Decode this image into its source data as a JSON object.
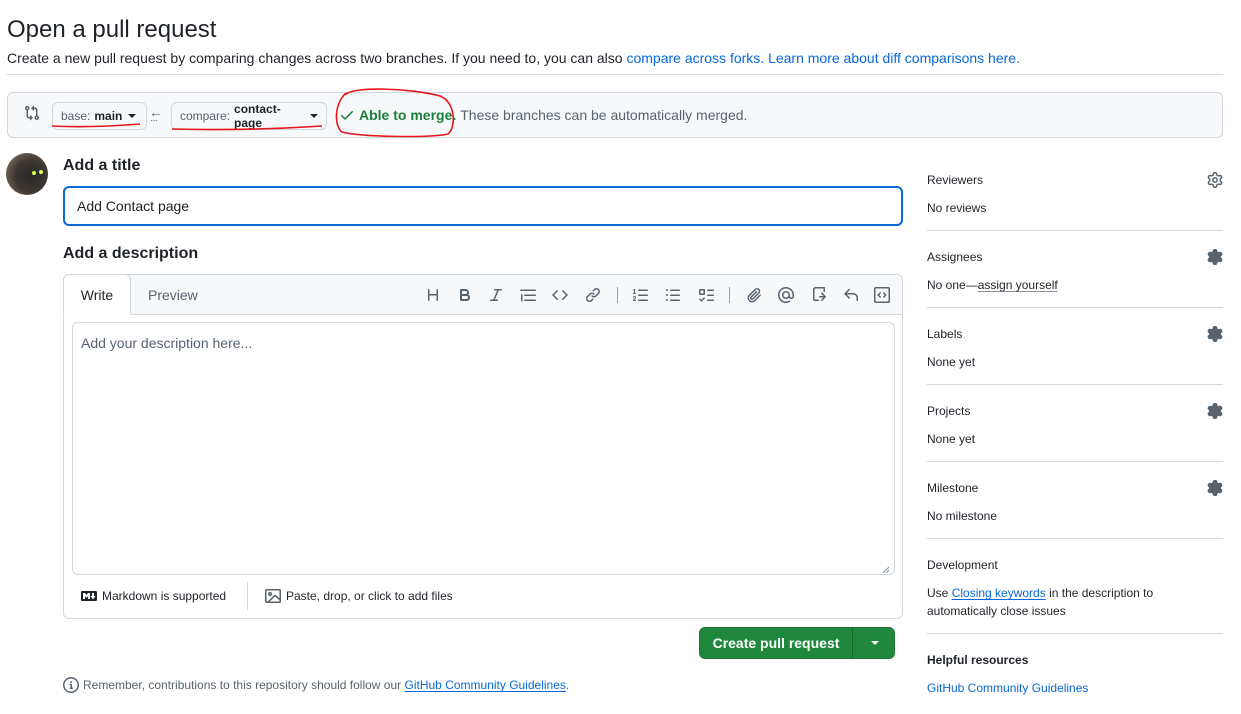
{
  "header": {
    "title": "Open a pull request",
    "subtitle_prefix": "Create a new pull request by comparing changes across two branches. If you need to, you can also ",
    "compare_forks_link": "compare across forks.",
    "learn_more_link": "Learn more about diff comparisons here."
  },
  "compare_bar": {
    "base_prefix": "base:",
    "base_branch": "main",
    "compare_prefix": "compare:",
    "compare_branch": "contact-page",
    "merge_status": "Able to merge.",
    "merge_description": "These branches can be automatically merged."
  },
  "form": {
    "title_label": "Add a title",
    "title_value": "Add Contact page",
    "description_label": "Add a description",
    "description_placeholder": "Add your description here...",
    "tab_write": "Write",
    "tab_preview": "Preview",
    "markdown_note": "Markdown is supported",
    "files_note": "Paste, drop, or click to add files",
    "create_button": "Create pull request"
  },
  "toolbar": [
    "heading",
    "bold",
    "italic",
    "quote",
    "code",
    "link",
    "numbered-list",
    "unordered-list",
    "task-list",
    "attach",
    "mention",
    "reference",
    "undo",
    "slash-commands"
  ],
  "footer": {
    "note_prefix": "Remember, contributions to this repository should follow our ",
    "guidelines_link": "GitHub Community Guidelines",
    "note_suffix": "."
  },
  "sidebar": {
    "reviewers": {
      "title": "Reviewers",
      "value": "No reviews"
    },
    "assignees": {
      "title": "Assignees",
      "value_prefix": "No one—",
      "value_link": "assign yourself"
    },
    "labels": {
      "title": "Labels",
      "value": "None yet"
    },
    "projects": {
      "title": "Projects",
      "value": "None yet"
    },
    "milestone": {
      "title": "Milestone",
      "value": "No milestone"
    },
    "development": {
      "title": "Development",
      "value_prefix": "Use ",
      "value_link": "Closing keywords",
      "value_suffix_1": " in the description to",
      "value_suffix_2": "automatically close issues"
    },
    "helpful": {
      "title": "Helpful resources",
      "link": "GitHub Community Guidelines"
    }
  },
  "colors": {
    "primary_button": "#1f883d",
    "link": "#0969da",
    "merge_ok": "#1a7f37",
    "annotation": "#e5161d"
  }
}
